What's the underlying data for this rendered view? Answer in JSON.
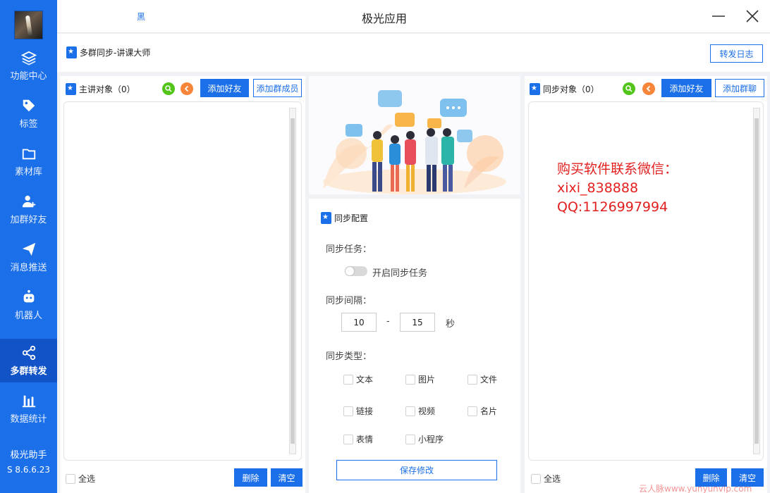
{
  "window": {
    "title": "极光应用",
    "title_mark": "黑"
  },
  "sidebar": {
    "items": [
      {
        "label": "功能中心",
        "icon": "layers-icon"
      },
      {
        "label": "标签",
        "icon": "tag-icon"
      },
      {
        "label": "素材库",
        "icon": "folder-icon"
      },
      {
        "label": "加群好友",
        "icon": "add-user-icon"
      },
      {
        "label": "消息推送",
        "icon": "send-icon"
      },
      {
        "label": "机器人",
        "icon": "robot-icon"
      },
      {
        "label": "多群转发",
        "icon": "share-icon"
      },
      {
        "label": "数据统计",
        "icon": "bar-chart-icon"
      }
    ],
    "active_index": 6,
    "brand": "极光助手",
    "version": "S 8.6.6.23"
  },
  "header": {
    "title": "多群同步-讲课大师",
    "log_button": "转发日志"
  },
  "left_panel": {
    "title": "主讲对象（0）",
    "add_friend": "添加好友",
    "add_group_member": "添加群成员",
    "select_all": "全选",
    "delete": "删除",
    "clear": "清空"
  },
  "center_panel": {
    "title": "同步配置",
    "task_label": "同步任务：",
    "task_toggle_label": "开启同步任务",
    "interval_label": "同步间隔：",
    "interval_min": "10",
    "interval_dash": "-",
    "interval_max": "15",
    "interval_unit": "秒",
    "type_label": "同步类型：",
    "types": [
      "文本",
      "图片",
      "文件",
      "链接",
      "视频",
      "名片",
      "表情",
      "小程序"
    ],
    "save": "保存修改"
  },
  "right_panel": {
    "title": "同步对象（0）",
    "add_friend": "添加好友",
    "add_group": "添加群聊",
    "contact_lines": [
      "购买软件联系微信：",
      "xixi_838888",
      "QQ:1126997994"
    ],
    "select_all": "全选",
    "delete": "删除",
    "clear": "清空"
  },
  "watermark": "云人脉www.yunyunvip.com",
  "colors": {
    "primary": "#1b6fe8",
    "sidebar_active": "#1253c7",
    "contact_text": "#e32020",
    "search_green": "#52c41a",
    "back_orange": "#f7863a"
  }
}
